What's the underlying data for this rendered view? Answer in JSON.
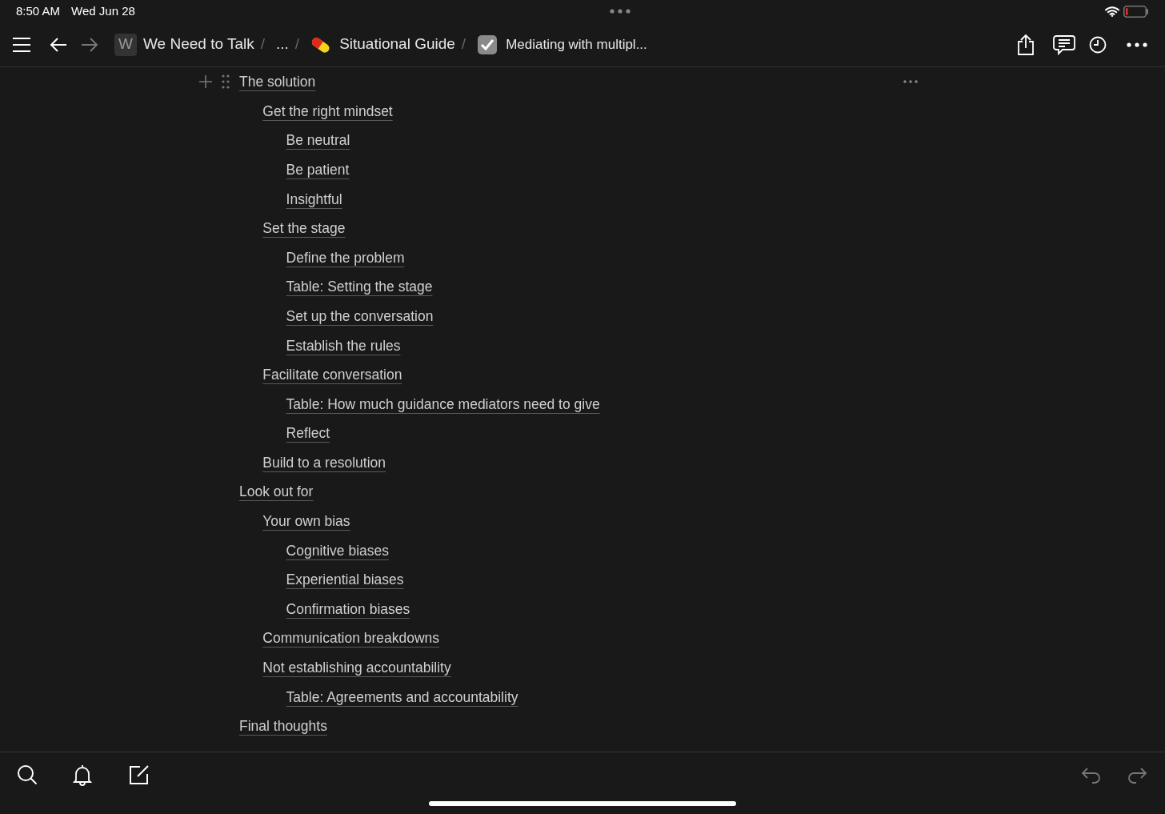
{
  "status_bar": {
    "time": "8:50 AM",
    "date": "Wed Jun 28"
  },
  "breadcrumbs": [
    {
      "kind": "workspace",
      "initial": "W",
      "label": "We Need to Talk",
      "separator": "/"
    },
    {
      "kind": "ellipsis",
      "label": "...",
      "separator": "/"
    },
    {
      "kind": "pill",
      "label": "Situational Guide",
      "separator": "/"
    },
    {
      "kind": "check",
      "label": "Mediating with multipl..."
    }
  ],
  "outline": [
    {
      "label": "The solution",
      "hovered": true,
      "children": [
        {
          "label": "Get the right mindset",
          "hovered": false,
          "children": [
            {
              "label": "Be neutral",
              "hovered": false
            },
            {
              "label": "Be patient",
              "hovered": false
            },
            {
              "label": "Insightful",
              "hovered": false
            }
          ]
        },
        {
          "label": "Set the stage",
          "hovered": false,
          "children": [
            {
              "label": "Define the problem",
              "hovered": false
            },
            {
              "label": "Table: Setting the stage",
              "hovered": false
            },
            {
              "label": "Set up the conversation",
              "hovered": false
            },
            {
              "label": "Establish the rules",
              "hovered": false
            }
          ]
        },
        {
          "label": "Facilitate conversation",
          "hovered": false,
          "children": [
            {
              "label": "Table: How much guidance mediators need to give",
              "hovered": false
            },
            {
              "label": "Reflect",
              "hovered": false
            }
          ]
        },
        {
          "label": "Build to a resolution",
          "hovered": false
        }
      ]
    },
    {
      "label": "Look out for",
      "hovered": false,
      "children": [
        {
          "label": "Your own bias",
          "hovered": false,
          "children": [
            {
              "label": "Cognitive biases",
              "hovered": false
            },
            {
              "label": "Experiential biases",
              "hovered": false
            },
            {
              "label": "Confirmation biases",
              "hovered": false
            }
          ]
        },
        {
          "label": "Communication breakdowns",
          "hovered": false
        },
        {
          "label": "Not establishing accountability",
          "hovered": false,
          "children": [
            {
              "label": "Table: Agreements and accountability",
              "hovered": false
            }
          ]
        }
      ]
    },
    {
      "label": "Final thoughts",
      "hovered": false
    }
  ]
}
